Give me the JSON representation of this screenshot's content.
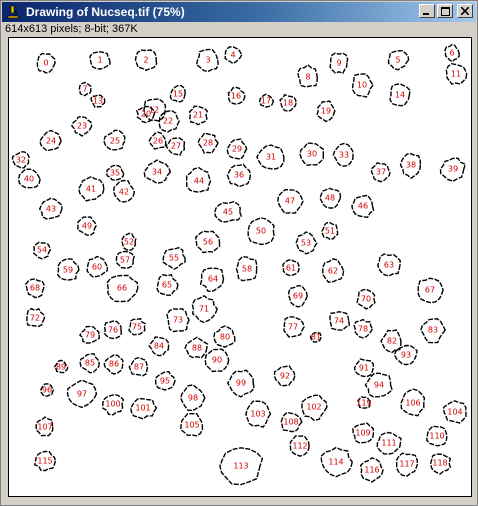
{
  "window": {
    "title": "Drawing of Nucseq.tif (75%)",
    "info": "614x613 pixels; 8-bit; 367K",
    "accent": "#0a246a",
    "label_color": "#d00000"
  },
  "controls": {
    "minimize": "minimize-icon",
    "maximize": "maximize-icon",
    "close": "close-icon"
  },
  "nuclei": [
    {
      "label": "0"
    },
    {
      "label": "1"
    },
    {
      "label": "2"
    },
    {
      "label": "3"
    },
    {
      "label": "4"
    },
    {
      "label": "5"
    },
    {
      "label": "6"
    },
    {
      "label": "7"
    },
    {
      "label": "8"
    },
    {
      "label": "9"
    },
    {
      "label": "10"
    },
    {
      "label": "11"
    },
    {
      "label": "12"
    },
    {
      "label": "13"
    },
    {
      "label": "14"
    },
    {
      "label": "15"
    },
    {
      "label": "16"
    },
    {
      "label": "17"
    },
    {
      "label": "18"
    },
    {
      "label": "19"
    },
    {
      "label": "20"
    },
    {
      "label": "21"
    },
    {
      "label": "22"
    },
    {
      "label": "23"
    },
    {
      "label": "24"
    },
    {
      "label": "25"
    },
    {
      "label": "26"
    },
    {
      "label": "27"
    },
    {
      "label": "28"
    },
    {
      "label": "29"
    },
    {
      "label": "30"
    },
    {
      "label": "31"
    },
    {
      "label": "32"
    },
    {
      "label": "33"
    },
    {
      "label": "34"
    },
    {
      "label": "35"
    },
    {
      "label": "36"
    },
    {
      "label": "37"
    },
    {
      "label": "38"
    },
    {
      "label": "39"
    },
    {
      "label": "40"
    },
    {
      "label": "41"
    },
    {
      "label": "42"
    },
    {
      "label": "43"
    },
    {
      "label": "44"
    },
    {
      "label": "45"
    },
    {
      "label": "46"
    },
    {
      "label": "47"
    },
    {
      "label": "48"
    },
    {
      "label": "49"
    },
    {
      "label": "50"
    },
    {
      "label": "51"
    },
    {
      "label": "52"
    },
    {
      "label": "53"
    },
    {
      "label": "54"
    },
    {
      "label": "55"
    },
    {
      "label": "56"
    },
    {
      "label": "57"
    },
    {
      "label": "58"
    },
    {
      "label": "59"
    },
    {
      "label": "60"
    },
    {
      "label": "61"
    },
    {
      "label": "62"
    },
    {
      "label": "63"
    },
    {
      "label": "64"
    },
    {
      "label": "65"
    },
    {
      "label": "66"
    },
    {
      "label": "67"
    },
    {
      "label": "68"
    },
    {
      "label": "69"
    },
    {
      "label": "70"
    },
    {
      "label": "71"
    },
    {
      "label": "72"
    },
    {
      "label": "73"
    },
    {
      "label": "74"
    },
    {
      "label": "75"
    },
    {
      "label": "76"
    },
    {
      "label": "77"
    },
    {
      "label": "78"
    },
    {
      "label": "79"
    },
    {
      "label": "80"
    },
    {
      "label": "81"
    },
    {
      "label": "82"
    },
    {
      "label": "83"
    },
    {
      "label": "84"
    },
    {
      "label": "85"
    },
    {
      "label": "86"
    },
    {
      "label": "87"
    },
    {
      "label": "88"
    },
    {
      "label": "89"
    },
    {
      "label": "90"
    },
    {
      "label": "91"
    },
    {
      "label": "92"
    },
    {
      "label": "93"
    },
    {
      "label": "94"
    },
    {
      "label": "95"
    },
    {
      "label": "96"
    },
    {
      "label": "97"
    },
    {
      "label": "98"
    },
    {
      "label": "99"
    },
    {
      "label": "100"
    },
    {
      "label": "101"
    },
    {
      "label": "102"
    },
    {
      "label": "103"
    },
    {
      "label": "104"
    },
    {
      "label": "105"
    },
    {
      "label": "106"
    },
    {
      "label": "107"
    },
    {
      "label": "108"
    },
    {
      "label": "109"
    },
    {
      "label": "110"
    },
    {
      "label": "111"
    },
    {
      "label": "112"
    },
    {
      "label": "113"
    },
    {
      "label": "114"
    },
    {
      "label": "115"
    },
    {
      "label": "116"
    },
    {
      "label": "117"
    },
    {
      "label": "118"
    },
    {
      "label": "119"
    }
  ]
}
